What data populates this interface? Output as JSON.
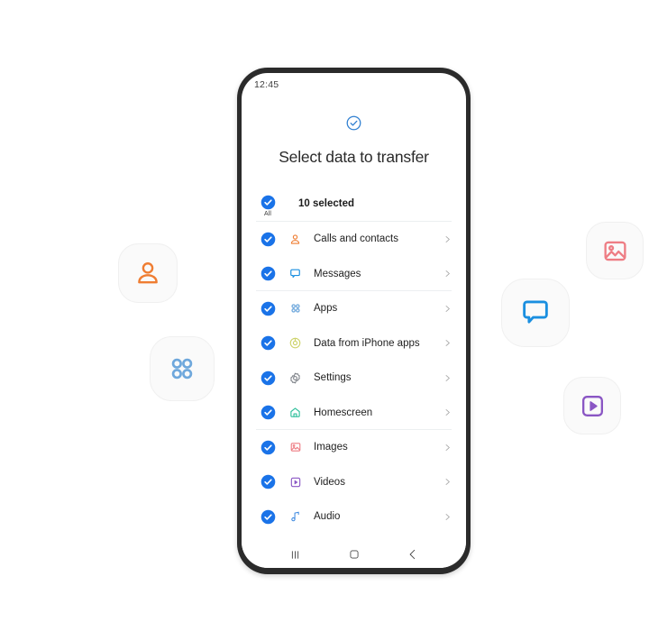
{
  "phone": {
    "status_bar": {
      "time": "12:45"
    },
    "header": {
      "icon": "check-circle-icon",
      "title": "Select data to transfer"
    },
    "select_all_row": {
      "checkbox_state": "checked",
      "all_label": "All",
      "count_text": "10 selected"
    },
    "items": [
      {
        "label": "Calls and contacts",
        "icon": "person-icon",
        "color": "#ef7d32",
        "checked": true,
        "separator_after": false
      },
      {
        "label": "Messages",
        "icon": "chat-bubble-icon",
        "color": "#1a8fe0",
        "checked": true,
        "separator_after": true
      },
      {
        "label": "Apps",
        "icon": "apps-grid-icon",
        "color": "#6fa8dc",
        "checked": true,
        "separator_after": false
      },
      {
        "label": "Data from iPhone apps",
        "icon": "target-icon",
        "color": "#cdd36a",
        "checked": true,
        "separator_after": false
      },
      {
        "label": "Settings",
        "icon": "gear-icon",
        "color": "#7b7f86",
        "checked": true,
        "separator_after": false
      },
      {
        "label": "Homescreen",
        "icon": "home-icon",
        "color": "#2fbf9b",
        "checked": true,
        "separator_after": true
      },
      {
        "label": "Images",
        "icon": "image-icon",
        "color": "#ee7d84",
        "checked": true,
        "separator_after": false
      },
      {
        "label": "Videos",
        "icon": "video-play-icon",
        "color": "#8a56c4",
        "checked": true,
        "separator_after": false
      },
      {
        "label": "Audio",
        "icon": "music-note-icon",
        "color": "#3f8ae0",
        "checked": true,
        "separator_after": false
      }
    ],
    "nav_bar": {
      "recents": "recents-icon",
      "home": "home-square-icon",
      "back": "back-chevron-icon"
    }
  },
  "floating_icons": [
    {
      "name": "contacts-tile",
      "icon": "person-icon",
      "color": "#ef7d32"
    },
    {
      "name": "apps-tile",
      "icon": "apps-grid-icon",
      "color": "#6fa8dc"
    },
    {
      "name": "messages-tile",
      "icon": "chat-bubble-icon",
      "color": "#1a8fe0"
    },
    {
      "name": "images-tile",
      "icon": "image-icon",
      "color": "#ee7d84"
    },
    {
      "name": "videos-tile",
      "icon": "video-play-icon",
      "color": "#8a56c4"
    }
  ],
  "colors": {
    "checkbox_blue": "#1a73e8",
    "bezel": "#2b2b2b",
    "screen_bg": "#ffffff",
    "separator": "#eceff1",
    "tile_bg": "#fafafa"
  }
}
